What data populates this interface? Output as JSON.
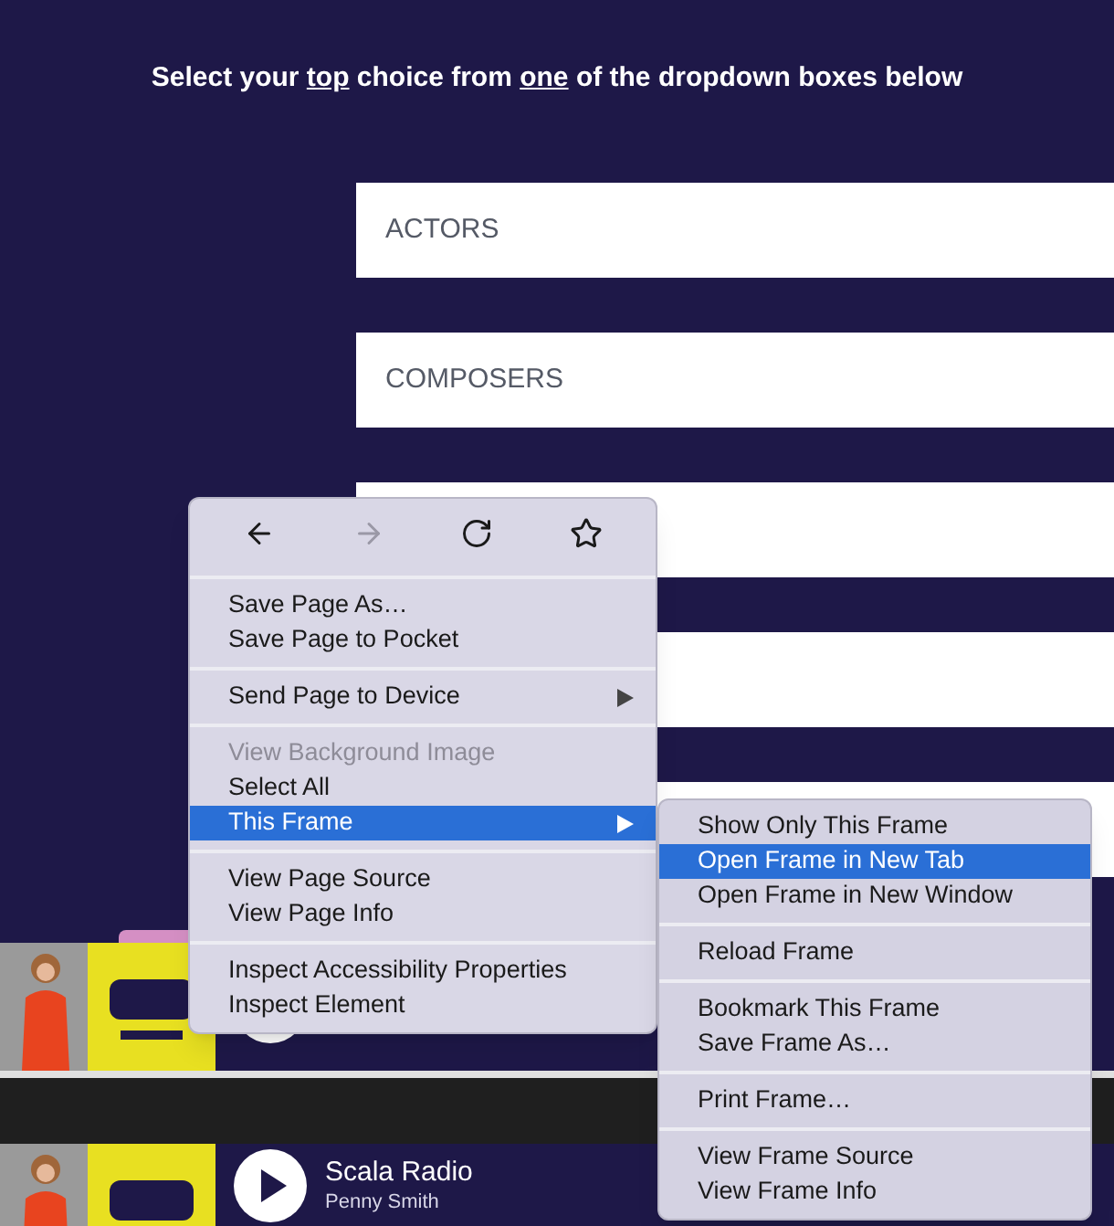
{
  "heading": [
    {
      "text": "Select your ",
      "underline": false
    },
    {
      "text": "top",
      "underline": true
    },
    {
      "text": " choice from ",
      "underline": false
    },
    {
      "text": "one",
      "underline": true
    },
    {
      "text": " of the dropdown boxes below",
      "underline": false
    }
  ],
  "dropdowns": [
    "ACTORS",
    "COMPOSERS"
  ],
  "players": [
    {
      "kind": "covered"
    },
    {
      "kind": "full",
      "title": "Scala Radio",
      "subtitle": "Penny Smith"
    }
  ],
  "context_menu": {
    "nav": [
      {
        "kind": "back",
        "disabled": false
      },
      {
        "kind": "forward",
        "disabled": true
      },
      {
        "kind": "reload",
        "disabled": false
      },
      {
        "kind": "bookmark",
        "disabled": false
      }
    ],
    "groups": [
      [
        {
          "label": "Save Page As…",
          "disabled": false,
          "selected": false,
          "submenu": false
        },
        {
          "label": "Save Page to Pocket",
          "disabled": false,
          "selected": false,
          "submenu": false
        }
      ],
      [
        {
          "label": "Send Page to Device",
          "disabled": false,
          "selected": false,
          "submenu": true
        }
      ],
      [
        {
          "label": "View Background Image",
          "disabled": true,
          "selected": false,
          "submenu": false
        },
        {
          "label": "Select All",
          "disabled": false,
          "selected": false,
          "submenu": false
        },
        {
          "label": "This Frame",
          "disabled": false,
          "selected": true,
          "submenu": true
        }
      ],
      [
        {
          "label": "View Page Source",
          "disabled": false,
          "selected": false,
          "submenu": false
        },
        {
          "label": "View Page Info",
          "disabled": false,
          "selected": false,
          "submenu": false
        }
      ],
      [
        {
          "label": "Inspect Accessibility Properties",
          "disabled": false,
          "selected": false,
          "submenu": false
        },
        {
          "label": "Inspect Element",
          "disabled": false,
          "selected": false,
          "submenu": false
        }
      ]
    ]
  },
  "submenu": {
    "groups": [
      [
        {
          "label": "Show Only This Frame",
          "disabled": false,
          "selected": false
        },
        {
          "label": "Open Frame in New Tab",
          "disabled": false,
          "selected": true
        },
        {
          "label": "Open Frame in New Window",
          "disabled": false,
          "selected": false
        }
      ],
      [
        {
          "label": "Reload Frame",
          "disabled": false,
          "selected": false
        }
      ],
      [
        {
          "label": "Bookmark This Frame",
          "disabled": false,
          "selected": false
        },
        {
          "label": "Save Frame As…",
          "disabled": false,
          "selected": false
        }
      ],
      [
        {
          "label": "Print Frame…",
          "disabled": false,
          "selected": false
        }
      ],
      [
        {
          "label": "View Frame Source",
          "disabled": false,
          "selected": false
        },
        {
          "label": "View Frame Info",
          "disabled": false,
          "selected": false
        }
      ]
    ]
  }
}
